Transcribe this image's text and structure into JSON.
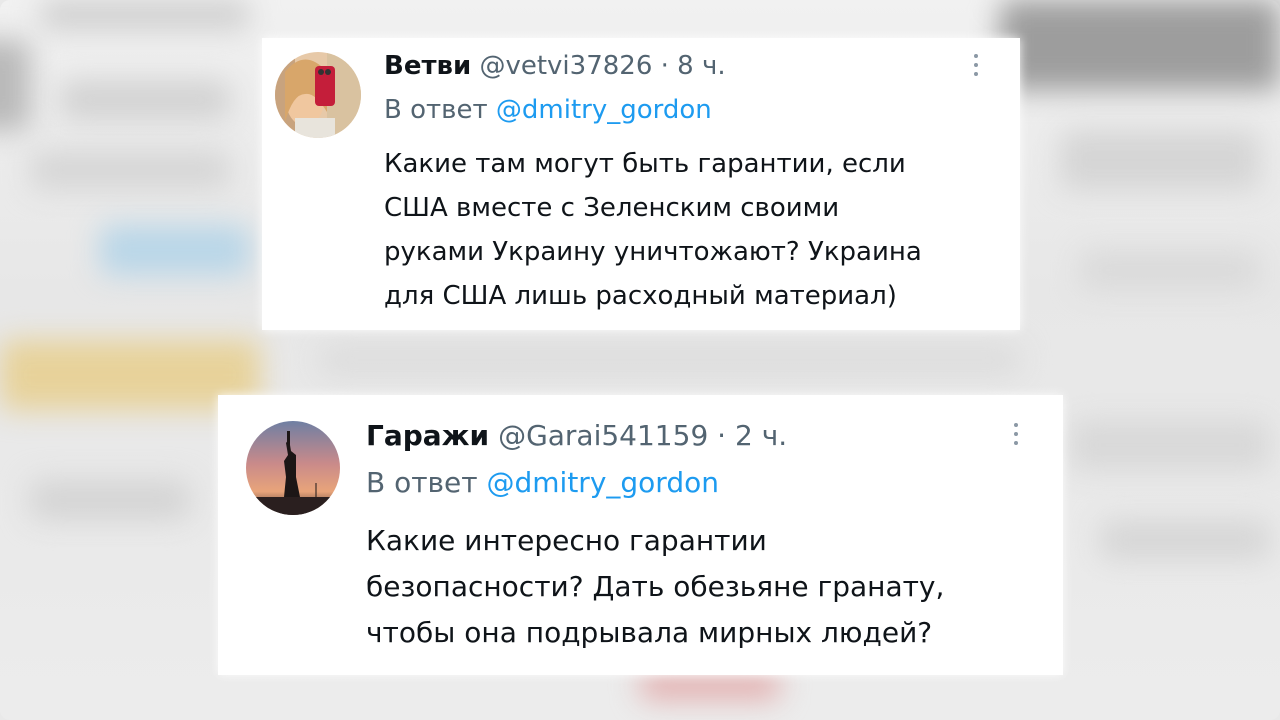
{
  "tweets": [
    {
      "name": "Ветви",
      "handle": "@vetvi37826",
      "time": "· 8 ч.",
      "reply_prefix": "В ответ",
      "reply_to": "@dmitry_gordon",
      "lines": [
        "Какие там могут быть гарантии, если",
        "США вместе с Зеленским своими",
        "руками Украину уничтожают? Украина",
        "для США лишь расходный материал)"
      ]
    },
    {
      "name": "Гаражи",
      "handle": "@Garai541159",
      "time": "· 2 ч.",
      "reply_prefix": "В ответ",
      "reply_to": "@dmitry_gordon",
      "lines": [
        "Какие интересно гарантии",
        "безопасности? Дать обезьяне гранату,",
        "чтобы она подрывала мирных людей?"
      ]
    }
  ],
  "icons": {
    "more": "more-vertical-icon",
    "avatar1": "avatar-photo",
    "avatar2": "avatar-sunset-statue"
  },
  "colors": {
    "text": "#0f1419",
    "secondary": "#536471",
    "mention": "#1d9bf0"
  }
}
